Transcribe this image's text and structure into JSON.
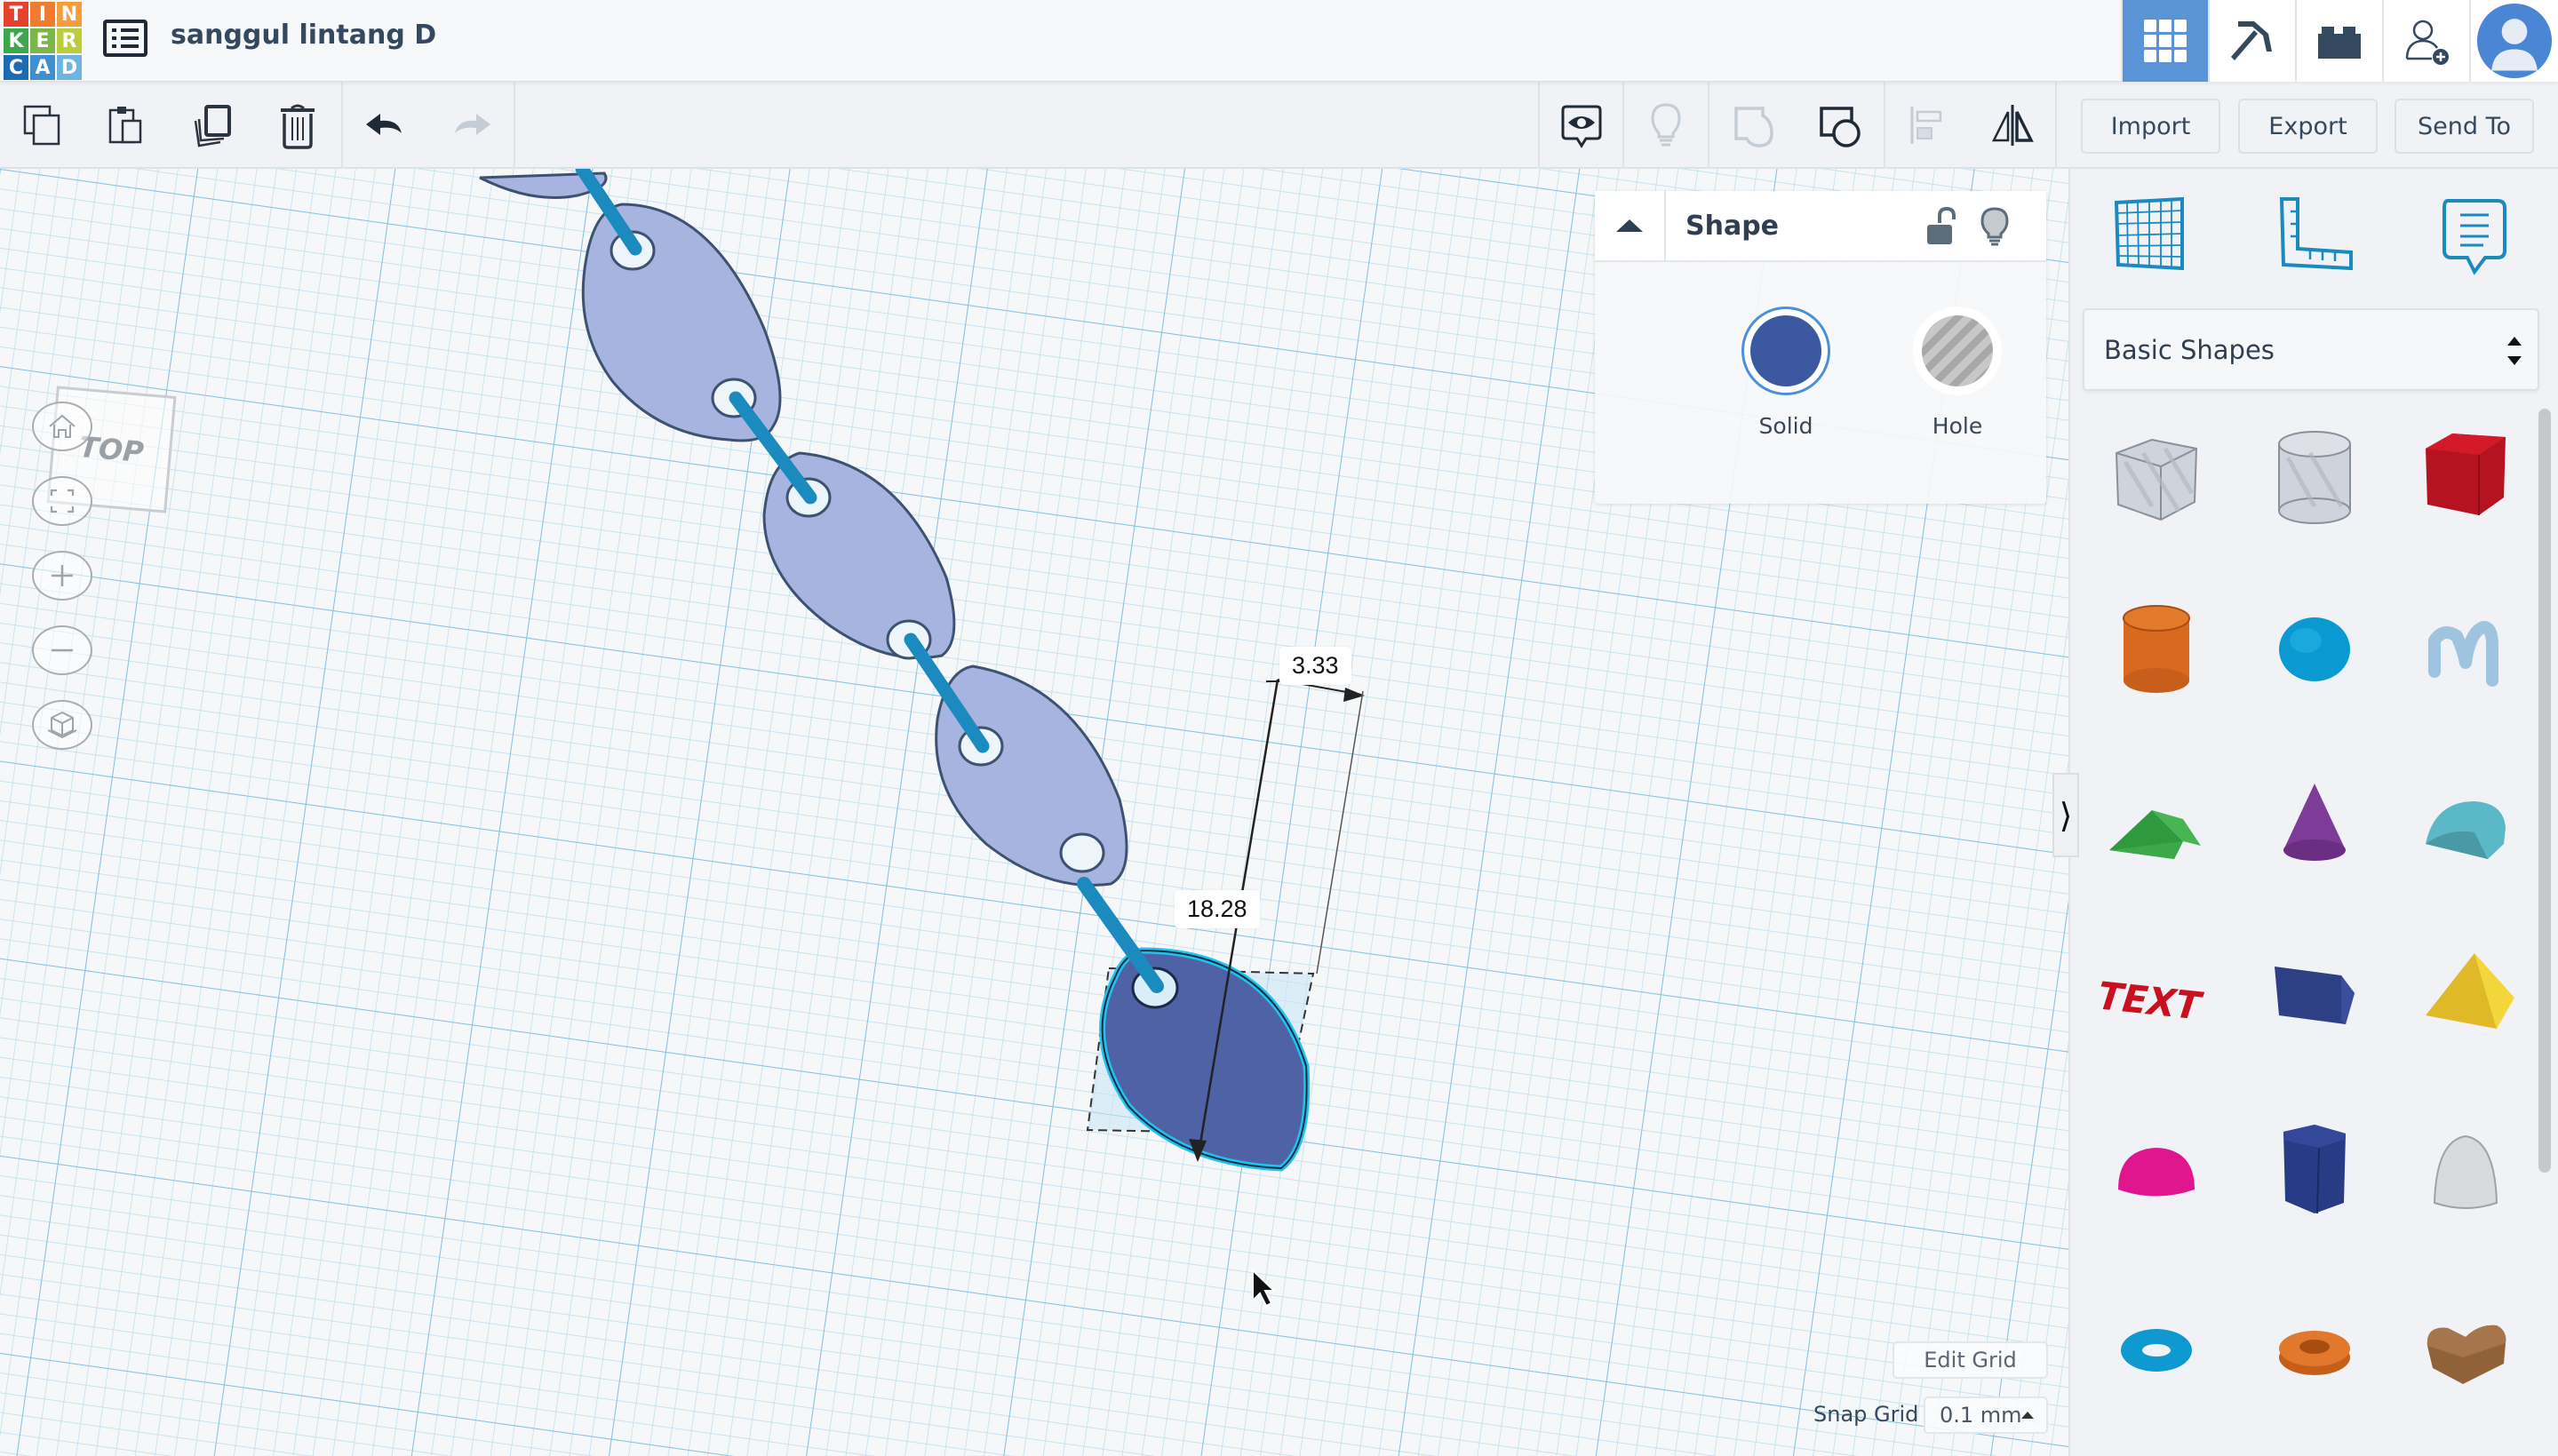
{
  "header": {
    "logo_letters": [
      "T",
      "I",
      "N",
      "K",
      "E",
      "R",
      "C",
      "A",
      "D"
    ],
    "logo_colors": [
      "#e5412d",
      "#f07c2f",
      "#f69c3b",
      "#3da74d",
      "#7ab648",
      "#bbcd3b",
      "#1c6bb3",
      "#3f8ecf",
      "#6cb4e2"
    ],
    "menu_icon": "list-icon",
    "design_title": "sanggul lintang D",
    "right_buttons": [
      {
        "name": "3d-design-view",
        "icon": "grid-icon",
        "active": true
      },
      {
        "name": "blocks-view",
        "icon": "pickaxe-icon",
        "active": false
      },
      {
        "name": "bricks-view",
        "icon": "brick-icon",
        "active": false
      },
      {
        "name": "invite-user",
        "icon": "add-user-icon",
        "active": false
      },
      {
        "name": "profile",
        "icon": "avatar-icon",
        "active": false
      }
    ],
    "accent_color": "#5b93d7"
  },
  "toolbar": {
    "left_tools": [
      {
        "name": "copy",
        "icon": "copy-icon"
      },
      {
        "name": "paste",
        "icon": "paste-icon"
      },
      {
        "name": "duplicate",
        "icon": "duplicate-icon"
      },
      {
        "name": "delete",
        "icon": "trash-icon"
      },
      {
        "name": "undo",
        "icon": "undo-icon"
      },
      {
        "name": "redo",
        "icon": "redo-icon",
        "disabled": true
      }
    ],
    "right_tools": [
      {
        "name": "notes",
        "icon": "eye-bubble-icon"
      },
      {
        "name": "show-hints",
        "icon": "lightbulb-icon",
        "disabled": true
      },
      {
        "name": "group",
        "icon": "group-icon",
        "disabled": true
      },
      {
        "name": "ungroup",
        "icon": "ungroup-icon"
      },
      {
        "name": "align",
        "icon": "align-icon",
        "disabled": true
      },
      {
        "name": "mirror",
        "icon": "mirror-icon"
      }
    ],
    "import_label": "Import",
    "export_label": "Export",
    "send_to_label": "Send To"
  },
  "workplane": {
    "view_cube_label": "TOP",
    "nav_controls": [
      {
        "name": "home-view",
        "icon": "home-icon"
      },
      {
        "name": "fit-all",
        "icon": "fit-icon"
      },
      {
        "name": "zoom-in",
        "icon": "plus-icon"
      },
      {
        "name": "zoom-out",
        "icon": "minus-icon"
      },
      {
        "name": "perspective",
        "icon": "cube-icon"
      }
    ],
    "dimension_width": "3.33",
    "dimension_length": "18.28",
    "edit_grid_label": "Edit Grid",
    "snap_grid_label": "Snap Grid",
    "snap_grid_value": "0.1 mm",
    "shape_color_unselected": "#a7b4e0",
    "shape_color_selected": "#4f62a5",
    "selection_outline": "#1fc4ec",
    "rod_color": "#1a8abf"
  },
  "shape_panel": {
    "title": "Shape",
    "lock_icon": "unlock-icon",
    "hint_icon": "lightbulb-icon",
    "options": [
      {
        "label": "Solid",
        "selected": true,
        "color": "#3b58a0"
      },
      {
        "label": "Hole",
        "selected": false
      }
    ]
  },
  "right_panel": {
    "tools": [
      {
        "name": "workplane",
        "icon": "workplane-grid-icon"
      },
      {
        "name": "ruler",
        "icon": "ruler-icon"
      },
      {
        "name": "notes",
        "icon": "note-bubble-icon"
      }
    ],
    "library_selected": "Basic Shapes",
    "collapse_icon": "chevron-right-icon",
    "shapes": [
      {
        "name": "Box Hole",
        "icon": "box-hole-icon"
      },
      {
        "name": "Cylinder Hole",
        "icon": "cylinder-hole-icon"
      },
      {
        "name": "Box",
        "icon": "box-icon"
      },
      {
        "name": "Cylinder",
        "icon": "cylinder-icon"
      },
      {
        "name": "Sphere",
        "icon": "sphere-icon"
      },
      {
        "name": "Scribble",
        "icon": "scribble-icon"
      },
      {
        "name": "Roof",
        "icon": "roof-icon"
      },
      {
        "name": "Cone",
        "icon": "cone-icon"
      },
      {
        "name": "Round Roof",
        "icon": "round-roof-icon"
      },
      {
        "name": "Text",
        "icon": "text-icon"
      },
      {
        "name": "Polygon",
        "icon": "polygon-icon"
      },
      {
        "name": "Pyramid",
        "icon": "pyramid-icon"
      },
      {
        "name": "Half Sphere",
        "icon": "half-sphere-icon"
      },
      {
        "name": "Hexagonal Prism",
        "icon": "hexagon-prism-icon"
      },
      {
        "name": "Paraboloid",
        "icon": "paraboloid-icon"
      },
      {
        "name": "Torus",
        "icon": "torus-icon"
      },
      {
        "name": "Tube",
        "icon": "tube-icon"
      },
      {
        "name": "Heart",
        "icon": "heart-icon"
      }
    ]
  }
}
